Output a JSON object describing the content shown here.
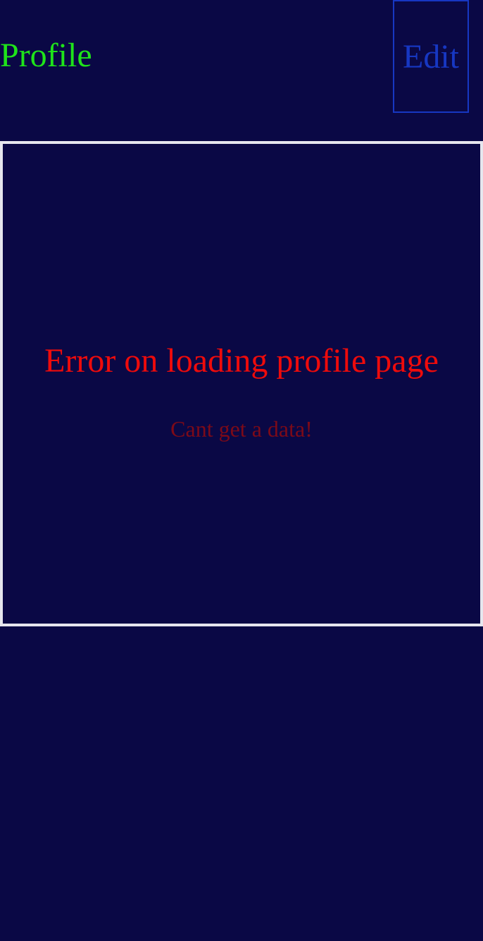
{
  "header": {
    "title": "Profile",
    "edit_label": "Edit"
  },
  "error": {
    "title": "Error on loading profile page",
    "message": "Cant get a data!"
  },
  "colors": {
    "background": "#0a0845",
    "title": "#1fe31a",
    "edit": "#1737c2",
    "error_title": "#ee0b0b",
    "error_message": "#7d0a18",
    "panel_border": "#e6e6ee"
  }
}
